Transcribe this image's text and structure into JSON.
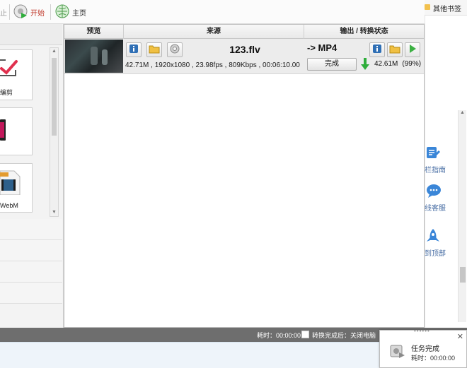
{
  "toolbar": {
    "stop_label": "止",
    "start_label": "开始",
    "home_label": "主页"
  },
  "left_panel": {
    "presets": [
      {
        "label": "编剪",
        "icon": "edit-check-icon"
      },
      {
        "label": "",
        "icon": "phone-icon"
      },
      {
        "label": "WebM",
        "icon": "webm-file-icon"
      }
    ]
  },
  "list": {
    "headers": {
      "preview": "预览",
      "source": "来源",
      "output_status": "输出 / 转换状态"
    },
    "row": {
      "filename": "123.flv",
      "file_info": "42.71M , 1920x1080 , 23.98fps , 809Kbps , 00:06:10.00",
      "output_format": "-> MP4",
      "status_button": "完成",
      "output_size": "42.61M",
      "output_percent": "(99%)"
    }
  },
  "statusbar": {
    "elapsed": "耗时：00:00:00",
    "after_convert": "转换完成后：关闭电脑"
  },
  "browser": {
    "bookmarks_label": "其他书签",
    "side_links": [
      {
        "label": "栏指南",
        "icon": "guide-icon"
      },
      {
        "label": "线客服",
        "icon": "chat-icon"
      },
      {
        "label": "到顶部",
        "icon": "rocket-icon"
      }
    ]
  },
  "notification": {
    "title": "任务完成",
    "time": "耗时：00:00:00"
  },
  "colors": {
    "start_red": "#c0392b",
    "status_bar_gray": "#6e6e6e",
    "done_arrow_green": "#2fae3c",
    "side_link_blue": "#4a6fa5"
  }
}
